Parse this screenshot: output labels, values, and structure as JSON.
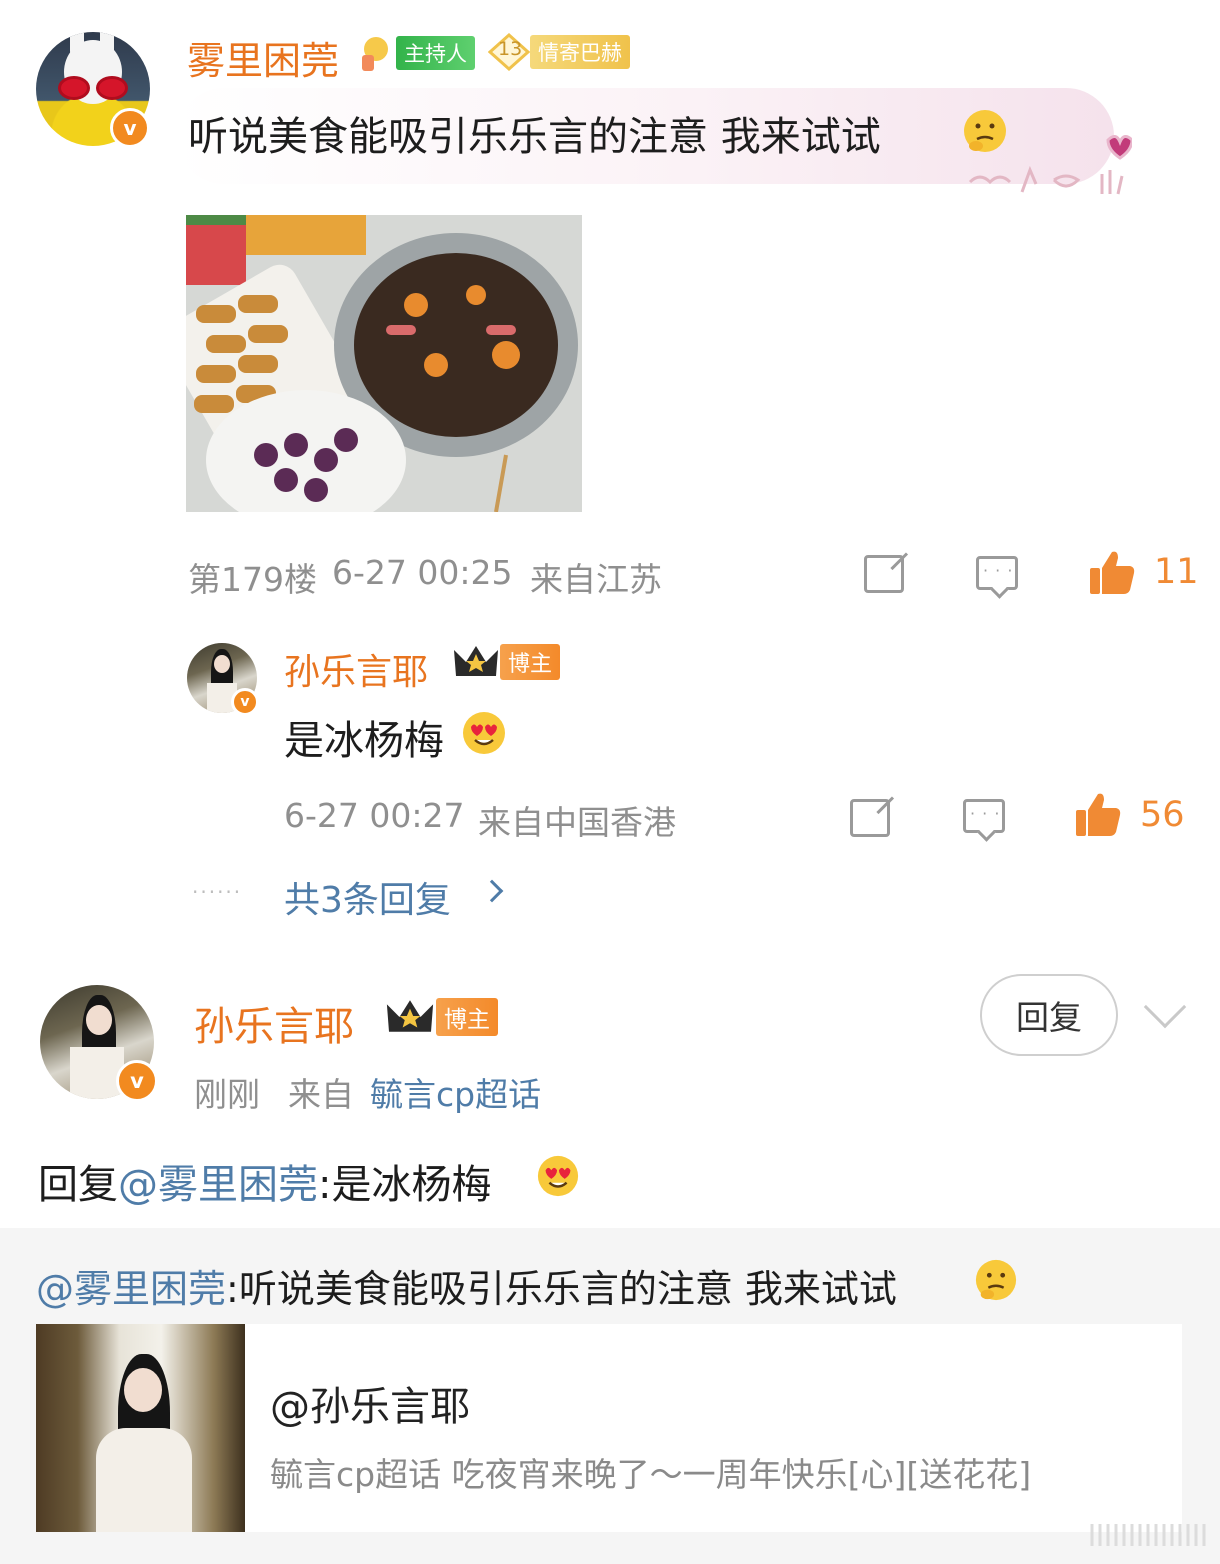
{
  "comment": {
    "user": "雾里困莞",
    "badges": [
      "主持人",
      "13",
      "情寄巴赫"
    ],
    "text": "听说美食能吸引乐乐言的注意 我来试试",
    "floor": "第179楼",
    "time": "6-27 00:25",
    "location": "来自江苏",
    "likes": "11"
  },
  "sub_reply": {
    "user": "孙乐言耶",
    "badge": "博主",
    "text": "是冰杨梅",
    "time": "6-27 00:27",
    "location": "来自中国香港",
    "likes": "56",
    "more": "共3条回复"
  },
  "post": {
    "user": "孙乐言耶",
    "badge": "博主",
    "time": "刚刚",
    "from_label": "来自",
    "source": "毓言cp超话",
    "reply_button": "回复",
    "reply_prefix": "回复",
    "mention": "@雾里困莞",
    "reply_text": ":是冰杨梅",
    "quote_mention": "@雾里困莞",
    "quote_text": ":听说美食能吸引乐乐言的注意 我来试试",
    "card_title": "@孙乐言耶",
    "card_desc": "毓言cp超话 吃夜宵来晚了～一周年快乐[心][送花花]"
  },
  "icons": [
    "share-icon",
    "comment-icon",
    "like-icon",
    "chevron-right-icon",
    "chevron-down-icon",
    "verified-icon",
    "crown-icon",
    "emoji-icon"
  ],
  "colors": {
    "accent": "#e8741f",
    "link": "#4f7ca8",
    "meta": "#8f8f8f",
    "like": "#f08a34"
  }
}
